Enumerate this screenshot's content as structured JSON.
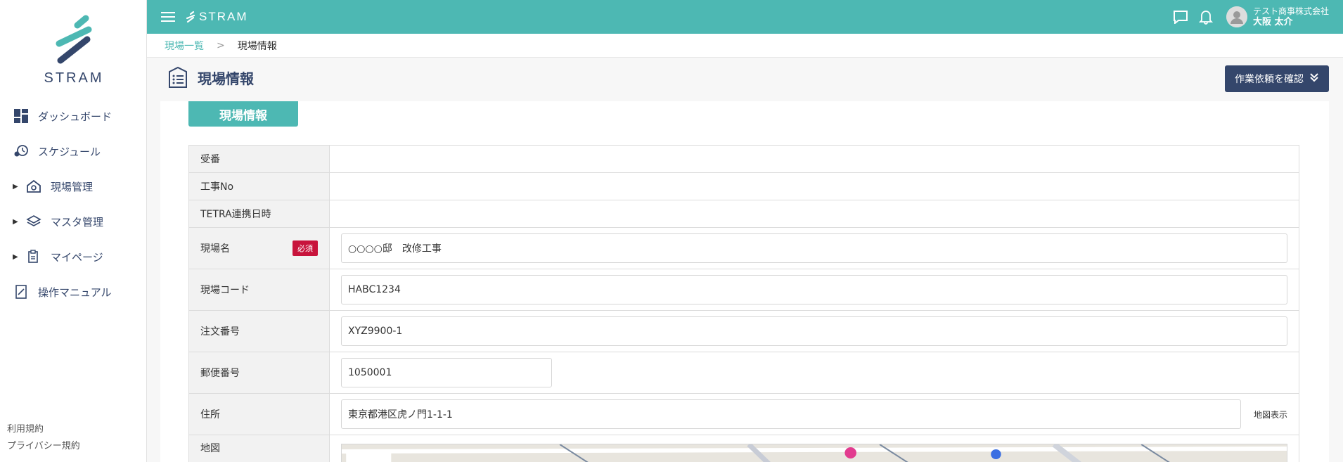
{
  "sidebar": {
    "logo_text": "STRAM",
    "items": [
      {
        "label": "ダッシュボード",
        "icon": "dashboard-icon",
        "has_caret": false
      },
      {
        "label": "スケジュール",
        "icon": "schedule-icon",
        "has_caret": false
      },
      {
        "label": "現場管理",
        "icon": "site-management-icon",
        "has_caret": true
      },
      {
        "label": "マスタ管理",
        "icon": "layers-icon",
        "has_caret": true
      },
      {
        "label": "マイページ",
        "icon": "mypage-icon",
        "has_caret": true
      },
      {
        "label": "操作マニュアル",
        "icon": "manual-icon",
        "has_caret": false
      }
    ],
    "footer": {
      "terms": "利用規約",
      "privacy": "プライバシー規約"
    }
  },
  "topbar": {
    "logo_text": "STRAM",
    "company": "テスト商事株式会社",
    "user_name": "大阪 太介",
    "bg_color": "#4db8b3"
  },
  "breadcrumb": {
    "parent": "現場一覧",
    "separator": ">",
    "current": "現場情報"
  },
  "page": {
    "title": "現場情報",
    "confirm_button": "作業依頼を確認",
    "section_tab": "現場情報"
  },
  "form": {
    "rows": [
      {
        "label": "受番",
        "value": ""
      },
      {
        "label": "工事No",
        "value": ""
      },
      {
        "label": "TETRA連携日時",
        "value": ""
      },
      {
        "label": "現場名",
        "required_badge": "必須",
        "value": "○○○○邸　改修工事"
      },
      {
        "label": "現場コード",
        "value": "HABC1234"
      },
      {
        "label": "注文番号",
        "value": "XYZ9900-1"
      },
      {
        "label": "郵便番号",
        "value": "1050001"
      },
      {
        "label": "住所",
        "value": "東京都港区虎ノ門1-1-1",
        "map_link": "地図表示"
      },
      {
        "label": "地図"
      }
    ]
  },
  "colors": {
    "accent": "#4db8b3",
    "navy": "#34466b",
    "required": "#c8143c"
  }
}
